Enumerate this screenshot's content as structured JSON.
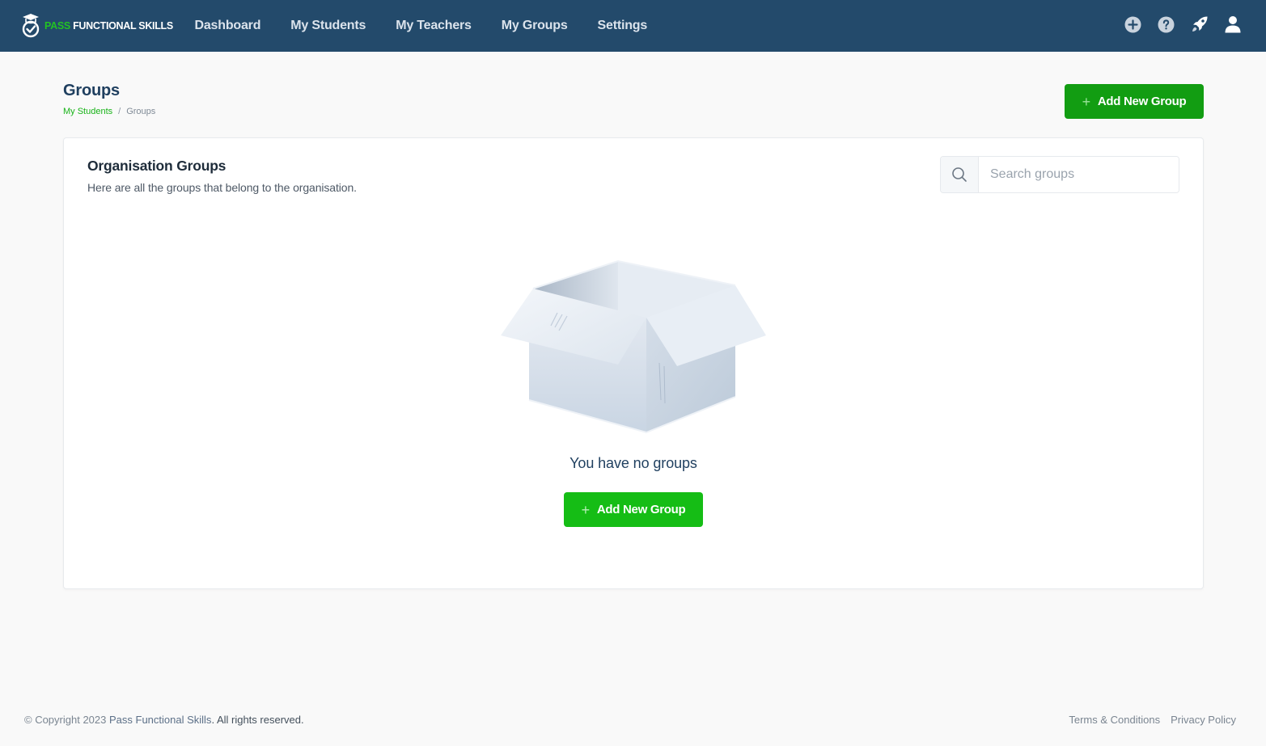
{
  "app": {
    "logo": {
      "part1": "PASS",
      "part2": " FUNCTIONAL SKILLS"
    },
    "nav": [
      {
        "label": "Dashboard"
      },
      {
        "label": "My Students"
      },
      {
        "label": "My Teachers"
      },
      {
        "label": "My Groups"
      },
      {
        "label": "Settings"
      }
    ],
    "top_icons": [
      "plus-circle-icon",
      "help-circle-icon",
      "rocket-icon",
      "user-icon"
    ]
  },
  "page": {
    "title": "Groups",
    "breadcrumb": [
      {
        "label": "My Students"
      },
      {
        "label": "Groups"
      }
    ],
    "breadcrumb_separator": "/",
    "add_button": {
      "icon": "+",
      "label": "Add New Group"
    }
  },
  "card": {
    "title": "Organisation Groups",
    "subtitle": "Here are all the groups that belong to the organisation.",
    "search": {
      "placeholder": "Search groups",
      "value": ""
    },
    "empty_state": {
      "illustration": "open-box-icon",
      "message": "You have no groups",
      "button": {
        "icon": "+",
        "label": "Add New Group"
      }
    }
  },
  "footer": {
    "copyright_prefix": "© Copyright 2023 ",
    "brand": "Pass Functional Skills",
    "copyright_suffix": ". All rights reserved.",
    "links": [
      {
        "label": "Terms & Conditions"
      },
      {
        "label": "Privacy Policy"
      }
    ]
  },
  "colors": {
    "navbar": "#234a6b",
    "brand_green": "#129d12",
    "accent_green": "#15bd15",
    "background": "#f9f9f9"
  }
}
